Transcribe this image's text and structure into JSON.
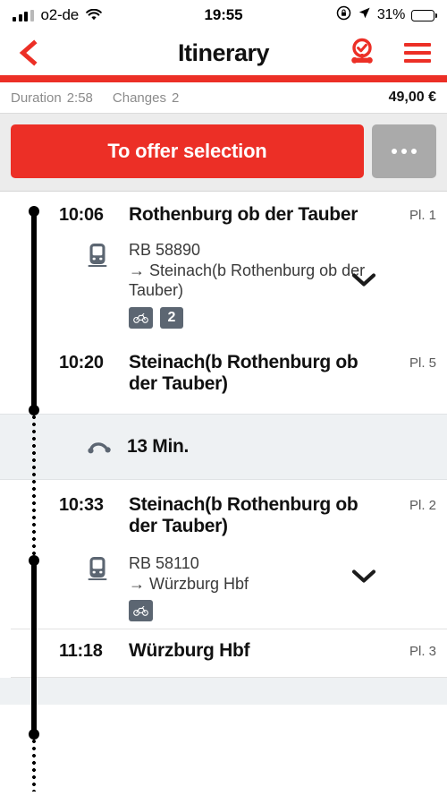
{
  "status_bar": {
    "carrier": "o2-de",
    "time": "19:55",
    "battery_percent": "31%",
    "signal_icon": "signal-bars-icon",
    "wifi_icon": "wifi-icon",
    "rotation_lock_icon": "rotation-lock-icon",
    "location_icon": "location-arrow-icon",
    "battery_icon": "battery-icon"
  },
  "nav": {
    "back_icon": "back-chevron-icon",
    "title": "Itinerary",
    "timer_icon": "stopwatch-icon",
    "menu_icon": "hamburger-menu-icon"
  },
  "summary": {
    "duration_label": "Duration",
    "duration_value": "2:58",
    "changes_label": "Changes",
    "changes_value": "2",
    "price": "49,00 €"
  },
  "actions": {
    "primary_label": "To offer selection",
    "more_label": "…",
    "more_icon": "ellipsis-icon"
  },
  "colors": {
    "accent_red": "#EC2F26",
    "badge_gray": "#5C6672",
    "more_button_gray": "#AAAAAA",
    "transfer_background": "#EEF1F3"
  },
  "itinerary": {
    "stops": [
      {
        "time": "10:06",
        "name": "Rothenburg ob der Tauber",
        "platform": "Pl. 1"
      },
      {
        "time": "10:20",
        "name": "Steinach(b Rothenburg ob der Tauber)",
        "platform": "Pl. 5"
      },
      {
        "time": "10:33",
        "name": "Steinach(b Rothenburg ob der Tauber)",
        "platform": "Pl. 2"
      },
      {
        "time": "11:18",
        "name": "Würzburg Hbf",
        "platform": "Pl. 3"
      }
    ],
    "legs": [
      {
        "train_icon": "train-icon",
        "train_number": "RB 58890",
        "direction": "→ Steinach(b Rothenburg ob der Tauber)",
        "expand_icon": "chevron-down-icon",
        "badges": [
          {
            "type": "icon",
            "icon": "bicycle-icon",
            "label": ""
          },
          {
            "type": "text",
            "icon": "",
            "label": "2"
          }
        ]
      },
      {
        "train_icon": "train-icon",
        "train_number": "RB 58110",
        "direction": "→ Würzburg Hbf",
        "expand_icon": "chevron-down-icon",
        "badges": [
          {
            "type": "icon",
            "icon": "bicycle-icon",
            "label": ""
          }
        ]
      }
    ],
    "transfer": {
      "icon": "transfer-walk-icon",
      "duration": "13 Min."
    }
  }
}
